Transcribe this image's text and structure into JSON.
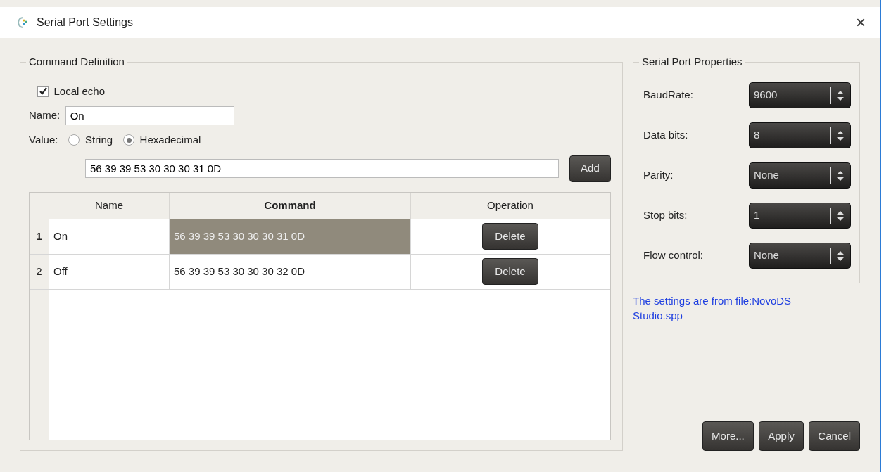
{
  "window": {
    "title": "Serial Port Settings",
    "close": "×"
  },
  "command_definition": {
    "title": "Command Definition",
    "local_echo": {
      "label": "Local echo",
      "checked": true
    },
    "name_label": "Name:",
    "name_value": "On",
    "value_label": "Value:",
    "value_types": [
      {
        "label": "String",
        "selected": false
      },
      {
        "label": "Hexadecimal",
        "selected": true
      }
    ],
    "command_value": "56 39 39 53 30 30 30 31 0D",
    "add_button": "Add",
    "table": {
      "columns": [
        {
          "label": "Name",
          "selected": false
        },
        {
          "label": "Command",
          "selected": true
        },
        {
          "label": "Operation",
          "selected": false
        }
      ],
      "rows": [
        {
          "number": "1",
          "name": "On",
          "command": "56 39 39 53 30 30 30 31 0D",
          "action": "Delete",
          "selected": true
        },
        {
          "number": "2",
          "name": "Off",
          "command": "56 39 39 53 30 30 30 32 0D",
          "action": "Delete",
          "selected": false
        }
      ]
    }
  },
  "serial_port_properties": {
    "title": "Serial Port Properties",
    "fields": [
      {
        "label": "BaudRate:",
        "value": "9600"
      },
      {
        "label": "Data bits:",
        "value": "8"
      },
      {
        "label": "Parity:",
        "value": "None"
      },
      {
        "label": "Stop bits:",
        "value": "1"
      },
      {
        "label": "Flow control:",
        "value": "None"
      }
    ]
  },
  "note": "The settings are from file:NovoDS Studio.spp",
  "buttons": [
    "More...",
    "Apply",
    "Cancel"
  ]
}
